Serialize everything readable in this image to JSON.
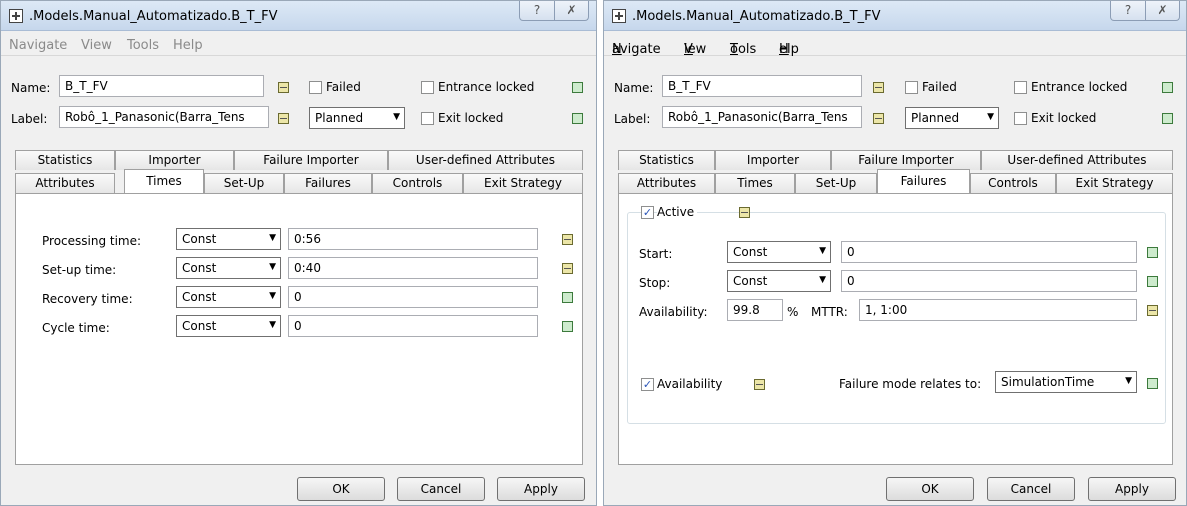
{
  "windows": [
    {
      "title": ".Models.Manual_Automatizado.B_T_FV",
      "help_icon": "?",
      "close_icon": "✗",
      "menu": [
        "Navigate",
        "View",
        "Tools",
        "Help"
      ],
      "name_label": "Name:",
      "name_value": "B_T_FV",
      "label_label": "Label:",
      "label_value": "Robô_1_Panasonic(Barra_Tens",
      "failed_label": "Failed",
      "planned_value": "Planned",
      "entrance_locked_label": "Entrance locked",
      "exit_locked_label": "Exit locked",
      "tabs_row1": [
        "Statistics",
        "Importer",
        "Failure Importer",
        "User-defined Attributes"
      ],
      "tabs_row2": [
        "Attributes",
        "Times",
        "Set-Up",
        "Failures",
        "Controls",
        "Exit Strategy"
      ],
      "active_tab": "Times",
      "times": [
        {
          "label": "Processing time:",
          "mode": "Const",
          "value": "0:56"
        },
        {
          "label": "Set-up time:",
          "mode": "Const",
          "value": "0:40"
        },
        {
          "label": "Recovery time:",
          "mode": "Const",
          "value": "0"
        },
        {
          "label": "Cycle time:",
          "mode": "Const",
          "value": "0"
        }
      ],
      "buttons": [
        "OK",
        "Cancel",
        "Apply"
      ]
    },
    {
      "title": ".Models.Manual_Automatizado.B_T_FV",
      "help_icon": "?",
      "close_icon": "✗",
      "menu": [
        "Navigate",
        "View",
        "Tools",
        "Help"
      ],
      "menu_underline": [
        "N",
        "V",
        "T",
        "H"
      ],
      "menu_rest": [
        "avigate",
        "iew",
        "ools",
        "elp"
      ],
      "name_label": "Name:",
      "name_value": "B_T_FV",
      "label_label": "Label:",
      "label_value": "Robô_1_Panasonic(Barra_Tens",
      "failed_label": "Failed",
      "planned_value": "Planned",
      "entrance_locked_label": "Entrance locked",
      "exit_locked_label": "Exit locked",
      "tabs_row1": [
        "Statistics",
        "Importer",
        "Failure Importer",
        "User-defined Attributes"
      ],
      "tabs_row2": [
        "Attributes",
        "Times",
        "Set-Up",
        "Failures",
        "Controls",
        "Exit Strategy"
      ],
      "active_tab": "Failures",
      "failures": {
        "active_label": "Active",
        "start_label": "Start:",
        "start_mode": "Const",
        "start_value": "0",
        "stop_label": "Stop:",
        "stop_mode": "Const",
        "stop_value": "0",
        "availability_label": "Availability:",
        "availability_value": "99.8",
        "percent": "%",
        "mttr_label": "MTTR:",
        "mttr_value": "1, 1:00",
        "availability_check_label": "Availability",
        "relates_label": "Failure mode relates to:",
        "relates_value": "SimulationTime"
      },
      "buttons": [
        "OK",
        "Cancel",
        "Apply"
      ]
    }
  ],
  "colors": {
    "indicator_green": "#cdebcd",
    "indicator_yellow": "#ece6a8",
    "titlebar": "#c6d7ec"
  }
}
